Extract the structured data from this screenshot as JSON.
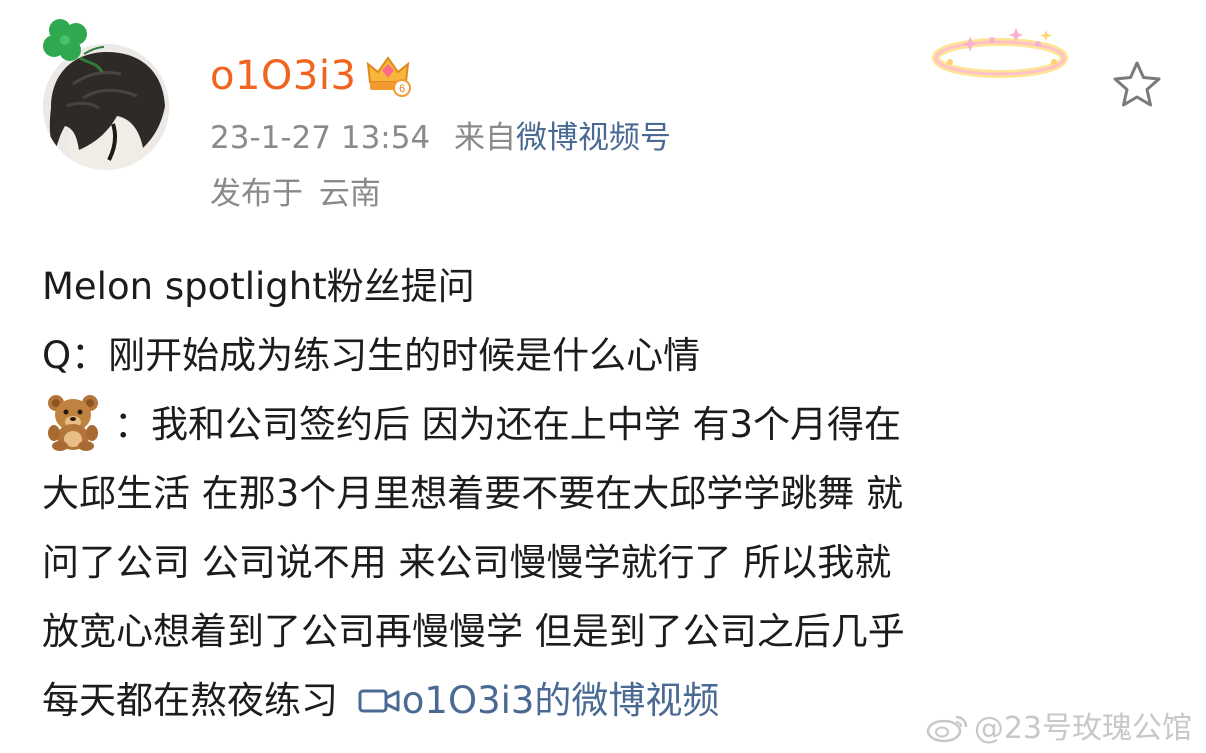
{
  "post": {
    "author": {
      "name": "o1O3i3",
      "vip_level": "6",
      "avatar_icon": "avatar-image",
      "badge_icon": "vip-crown-icon"
    },
    "timestamp": "23-1-27 13:54",
    "source_prefix": "来自",
    "source": "微博视频号",
    "location_prefix": "发布于",
    "location": "云南",
    "favorite_icon": "star-outline-icon",
    "decoration_icon": "halo-sparkle-icon",
    "content": {
      "line1": "Melon spotlight粉丝提问",
      "line2": "Q：刚开始成为练习生的时候是什么心情",
      "line3_icon": "teddy-bear-emoji",
      "line3": "：我和公司签约后 因为还在上中学 有3个月得在",
      "line4": "大邱生活 在那3个月里想着要不要在大邱学学跳舞 就",
      "line5": "问了公司 公司说不用 来公司慢慢学就行了 所以我就",
      "line6": "放宽心想着到了公司再慢慢学 但是到了公司之后几乎",
      "line7": "每天都在熬夜练习",
      "video_link_label": "o1O3i3的微博视频",
      "video_link_icon": "video-camera-icon"
    }
  },
  "watermark": {
    "text": "@23号玫瑰公馆",
    "logo_icon": "weibo-logo-icon"
  },
  "colors": {
    "username": "#f0641e",
    "meta": "#8a8a8a",
    "link": "#4a6a94",
    "text": "#1c1c1c",
    "watermark": "#c8c8c8"
  }
}
